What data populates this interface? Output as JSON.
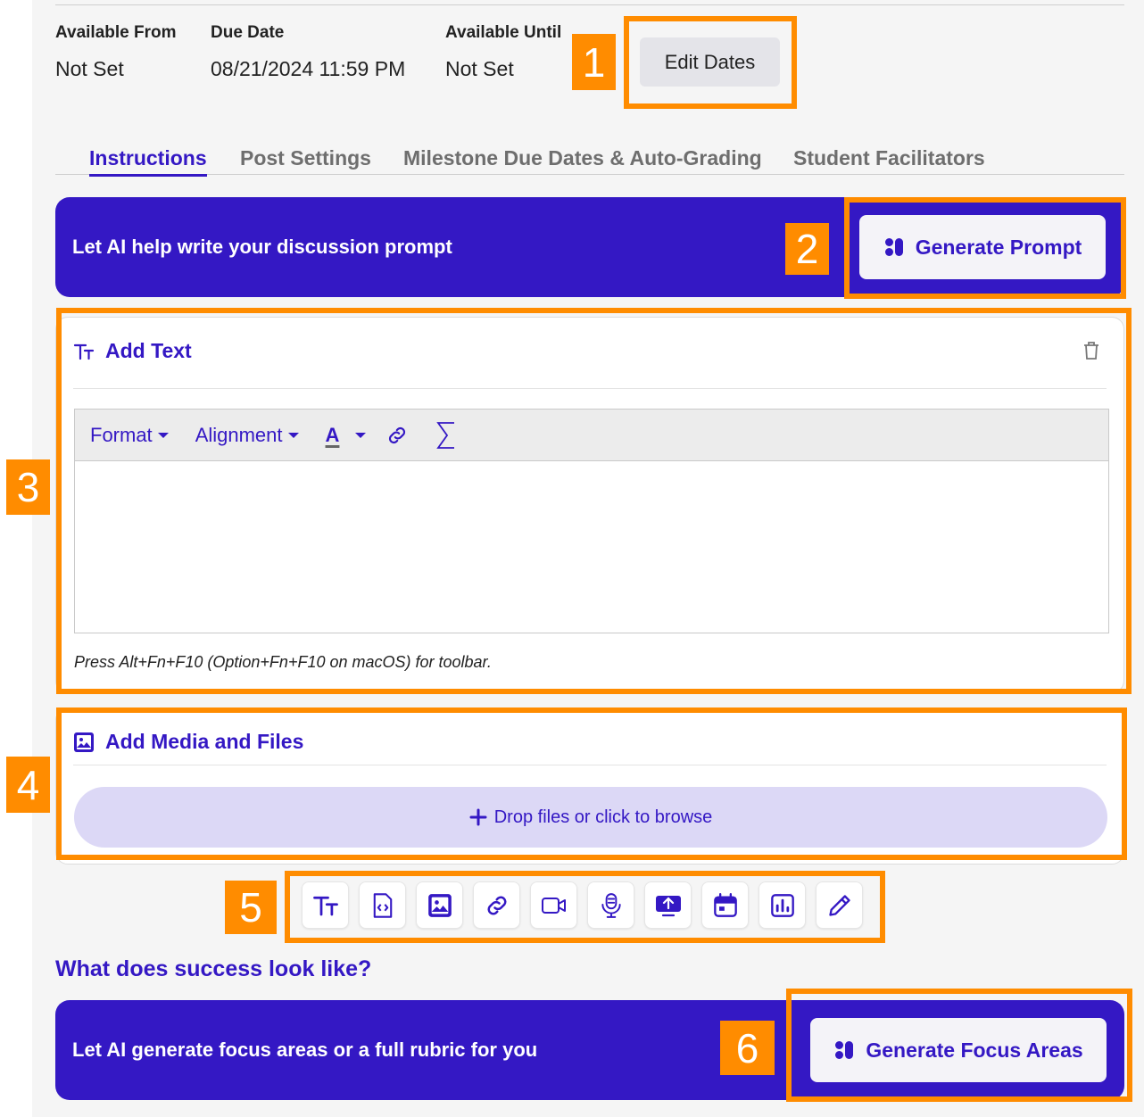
{
  "dates": {
    "available_from": {
      "label": "Available From",
      "value": "Not Set"
    },
    "due_date": {
      "label": "Due Date",
      "value": "08/21/2024 11:59 PM"
    },
    "available_until": {
      "label": "Available Until",
      "value": "Not Set"
    },
    "edit_button": "Edit Dates"
  },
  "tabs": [
    {
      "label": "Instructions",
      "active": true
    },
    {
      "label": "Post Settings",
      "active": false
    },
    {
      "label": "Milestone Due Dates & Auto-Grading",
      "active": false
    },
    {
      "label": "Student Facilitators",
      "active": false
    }
  ],
  "prompt_banner": {
    "text": "Let AI help write your discussion prompt",
    "button": "Generate Prompt"
  },
  "add_text": {
    "title": "Add Text",
    "toolbar": {
      "format": "Format",
      "alignment": "Alignment",
      "text_color_glyph": "A"
    },
    "editor_value": "",
    "hint": "Press Alt+Fn+F10 (Option+Fn+F10 on macOS) for toolbar."
  },
  "add_media": {
    "title": "Add Media and Files",
    "dropzone": "Drop files or click to browse"
  },
  "content_blocks": [
    "text-block-icon",
    "embed-code-icon",
    "image-icon",
    "link-icon",
    "video-icon",
    "audio-icon",
    "screen-recording-icon",
    "calendar-icon",
    "poll-icon",
    "drawing-icon"
  ],
  "success": {
    "heading": "What does success look like?",
    "banner_text": "Let AI generate focus areas or a full rubric for you",
    "button": "Generate Focus Areas"
  },
  "callouts": [
    "1",
    "2",
    "3",
    "4",
    "5",
    "6"
  ],
  "colors": {
    "accent": "#3418c4",
    "callout": "#ff8c00",
    "dropzone": "#dcd8f6"
  }
}
